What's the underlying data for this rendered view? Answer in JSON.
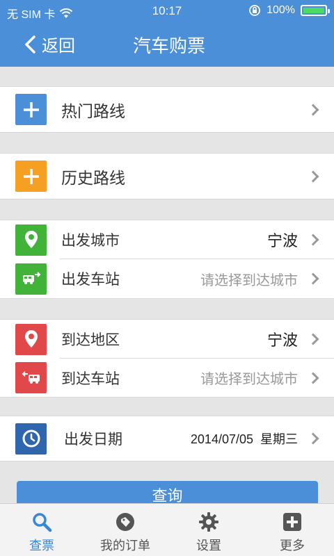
{
  "status_bar": {
    "carrier": "无 SIM 卡",
    "time": "10:17",
    "battery": "100%"
  },
  "nav": {
    "back_label": "返回",
    "title": "汽车购票"
  },
  "rows": {
    "hot_routes": {
      "label": "热门路线",
      "icon": "plus-icon",
      "color": "#4a8fd8"
    },
    "history_routes": {
      "label": "历史路线",
      "icon": "plus-icon",
      "color": "#f6a023"
    },
    "depart_city": {
      "label": "出发城市",
      "value": "宁波",
      "icon": "location-pin-icon",
      "color": "#41b339"
    },
    "depart_station": {
      "label": "出发车站",
      "value": "请选择到达城市",
      "icon": "bus-depart-icon",
      "color": "#41b339"
    },
    "arrive_region": {
      "label": "到达地区",
      "value": "宁波",
      "icon": "location-pin-icon",
      "color": "#e0484a"
    },
    "arrive_station": {
      "label": "到达车站",
      "value": "请选择到达城市",
      "icon": "bus-arrive-icon",
      "color": "#e0484a"
    },
    "depart_date": {
      "label": "出发日期",
      "value": "2014/07/05  星期三",
      "icon": "clock-icon",
      "color": "#2f66ad"
    }
  },
  "query_button": {
    "label": "查询"
  },
  "tabbar": {
    "items": [
      {
        "label": "查票",
        "icon": "search-icon",
        "active": true
      },
      {
        "label": "我的订单",
        "icon": "tag-icon",
        "active": false
      },
      {
        "label": "设置",
        "icon": "gear-icon",
        "active": false
      },
      {
        "label": "更多",
        "icon": "plus-square-icon",
        "active": false
      }
    ]
  }
}
